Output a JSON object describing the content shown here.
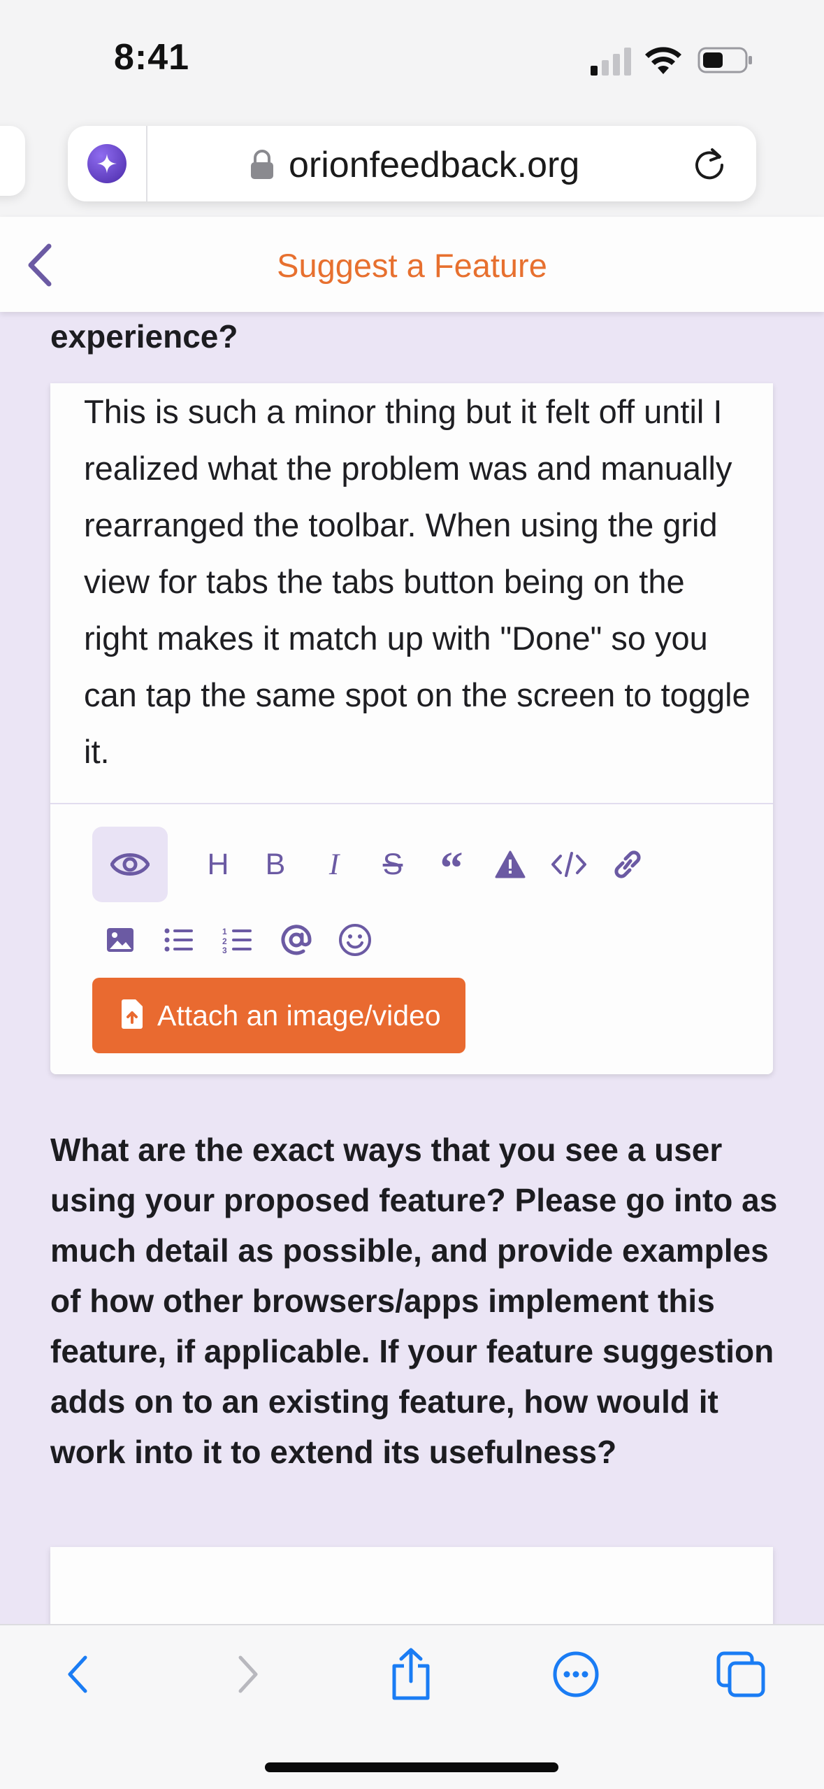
{
  "status_bar": {
    "time": "8:41"
  },
  "browser": {
    "url": "orionfeedback.org"
  },
  "header": {
    "title": "Suggest a Feature"
  },
  "prev_question_tail": "experience?",
  "editor": {
    "content": "This is such a minor thing but it felt off until I realized what the problem was and manually rearranged the toolbar. When using the grid view for tabs the tabs button being on the right makes it match up with \"Done\" so you can tap the same spot on the screen to toggle it.",
    "toolbar": {
      "heading_label": "H",
      "bold_label": "B",
      "italic_label": "I",
      "strike_label": "S",
      "quote_label": "“"
    },
    "attach_label": "Attach an image/video"
  },
  "next_question": "What are the exact ways that you see a user using your proposed feature? Please go into as much detail as possible, and provide examples of how other browsers/apps implement this feature, if applicable. If your feature suggestion adds on to an existing feature, how would it work into it to extend its usefulness?",
  "colors": {
    "accent": "#e96a30",
    "icon": "#6b5aa3",
    "background": "#ebe5f5",
    "safari_blue": "#1a7cf4"
  }
}
